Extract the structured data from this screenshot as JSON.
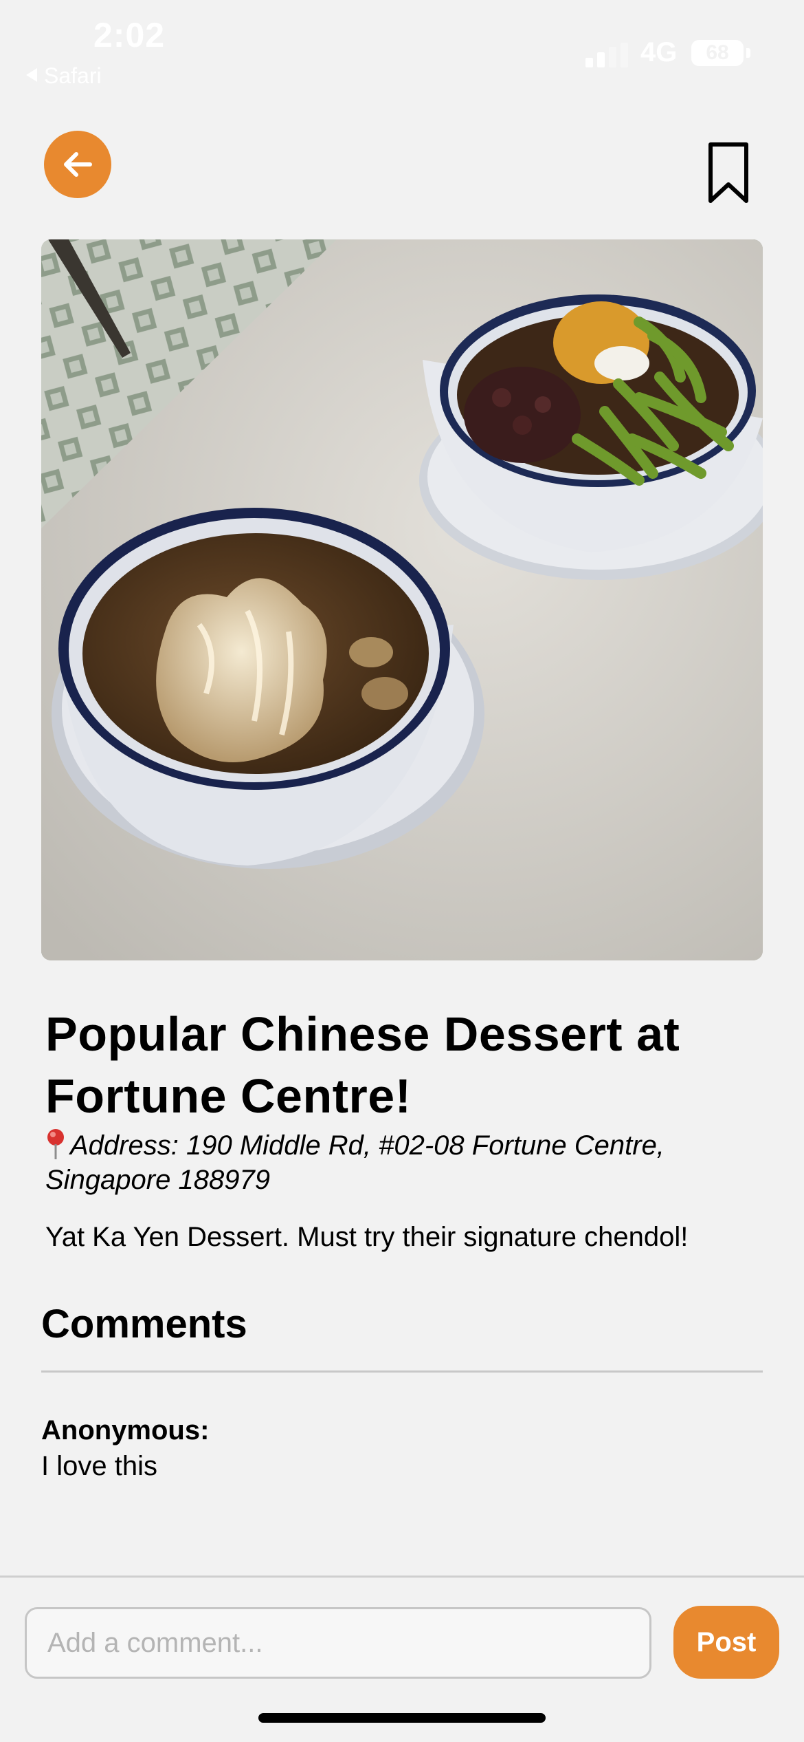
{
  "status_bar": {
    "time": "2:02",
    "back_app": "Safari",
    "network": "4G",
    "battery": "68"
  },
  "icons": {
    "back": "arrow-left-icon",
    "bookmark": "bookmark-icon",
    "location": "round-pushpin-icon"
  },
  "post": {
    "image_alt": "Two bowls of dessert: shaved ice dessert and chendol",
    "title": "Popular Chinese Dessert at Fortune Centre!",
    "address": "Address: 190 Middle Rd, #02-08 Fortune Centre, Singapore 188979",
    "description": "Yat Ka Yen Dessert. Must try their signature chendol!"
  },
  "comments": {
    "heading": "Comments",
    "items": [
      {
        "author": "Anonymous:",
        "text": "I love this"
      }
    ]
  },
  "composer": {
    "placeholder": "Add a comment...",
    "post_label": "Post"
  },
  "colors": {
    "accent": "#e8892f",
    "background": "#f2f2f2",
    "divider": "#c8c8c8"
  }
}
